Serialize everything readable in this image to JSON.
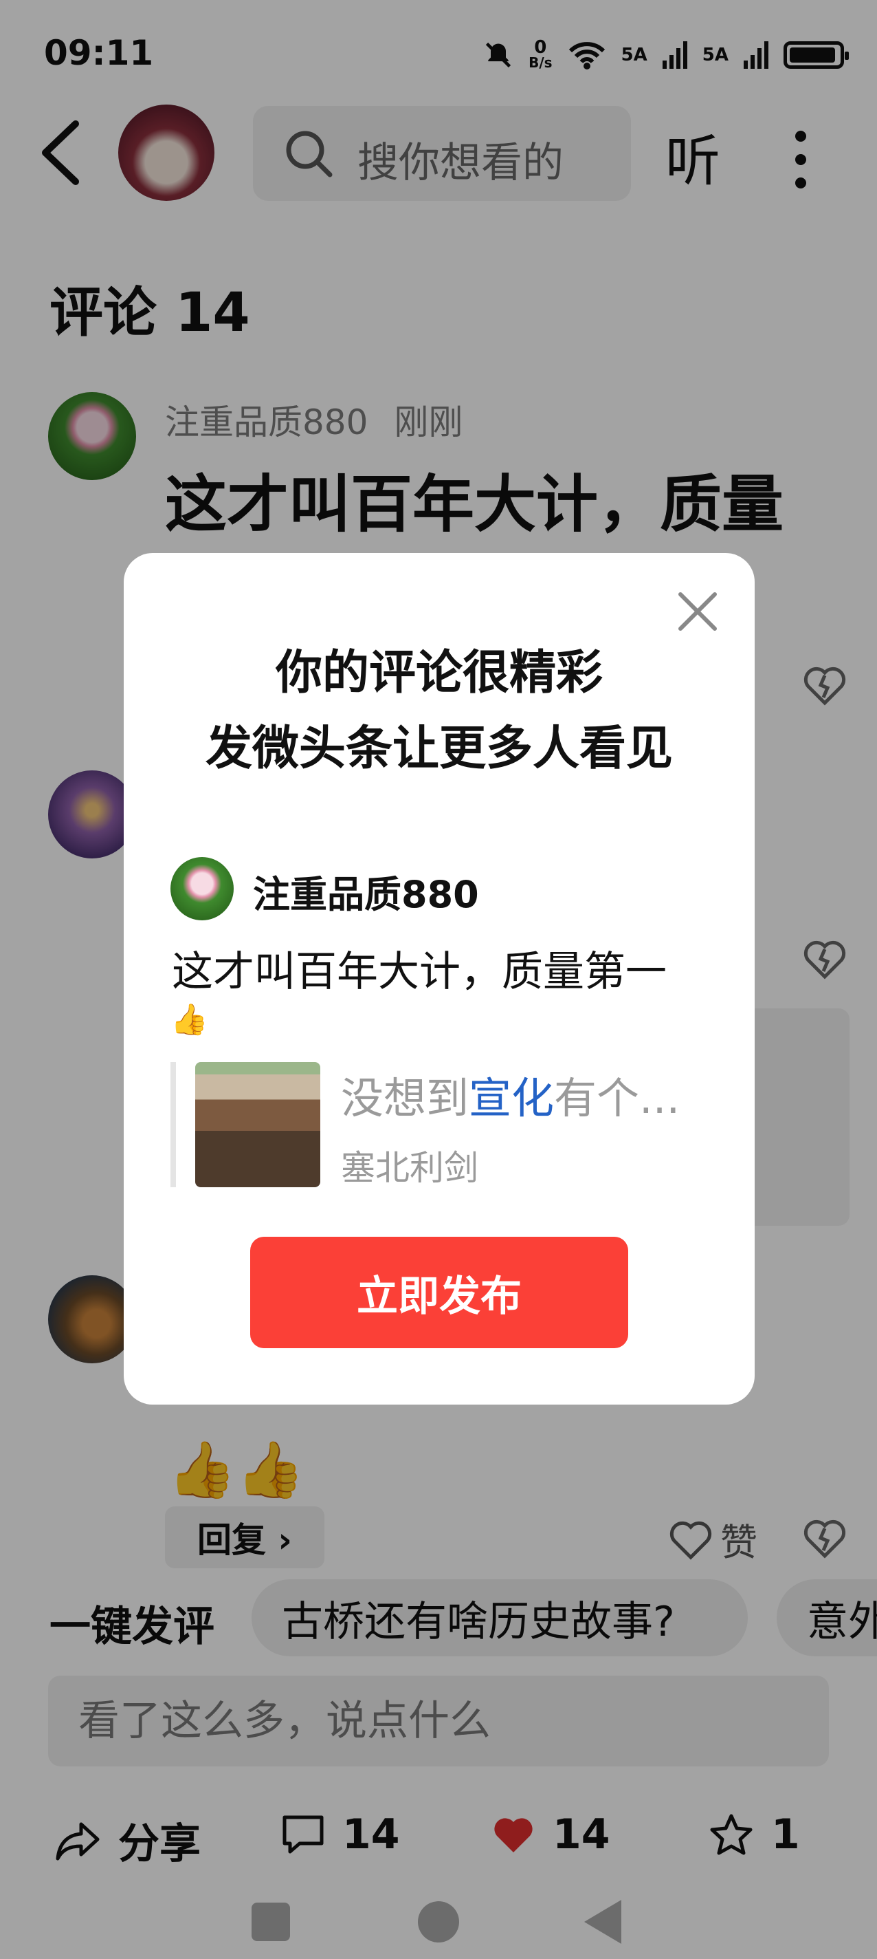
{
  "status_bar": {
    "time": "09:11",
    "net_speed_value": "0",
    "net_speed_unit": "B/s",
    "net1": "5A",
    "net2": "5A"
  },
  "header": {
    "search_placeholder": "搜你想看的",
    "listen_label": "听"
  },
  "comments_section": {
    "title": "评论 14",
    "first_comment": {
      "user": "注重品质880",
      "time": "刚刚",
      "text": "这才叫百年大计，质量"
    },
    "thumb_emojis": "👍👍",
    "reply_label": "回复 ›",
    "like_label": "赞"
  },
  "quick_bar": {
    "label": "一键发评",
    "chips": [
      "古桥还有啥历史故事?",
      "意外"
    ],
    "input_placeholder": "看了这么多，说点什么"
  },
  "action_bar": {
    "share_label": "分享",
    "comment_count": "14",
    "like_count": "14",
    "fav_count": "1"
  },
  "modal": {
    "title_line1": "你的评论很精彩",
    "title_line2": "发微头条让更多人看见",
    "user": "注重品质880",
    "comment_text": "这才叫百年大计，质量第一",
    "comment_emoji": "👍",
    "article_prefix": "没想到",
    "article_highlight": "宣化",
    "article_suffix": "有个...",
    "article_source": "塞北利剑",
    "publish_label": "立即发布"
  },
  "colors": {
    "publish_red": "#fb4037",
    "highlight_blue": "#2462c6",
    "like_red": "#e02e2e"
  }
}
